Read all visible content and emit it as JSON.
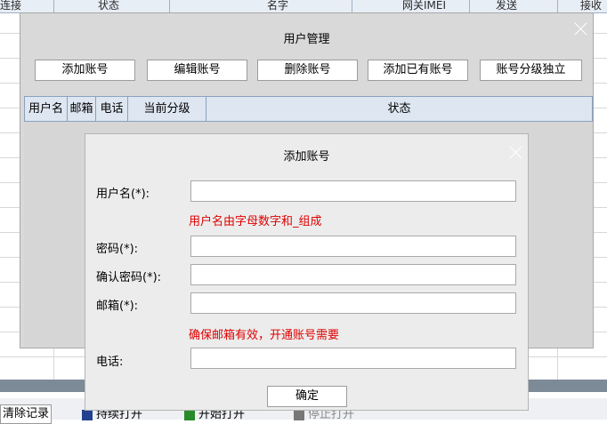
{
  "background": {
    "columns": [
      "连接",
      "状态",
      "名字",
      "网关IMEI",
      "发送",
      "接收"
    ],
    "bottom_buttons": {
      "clear_record": "清除记录",
      "btn2": "持续打开",
      "btn3": "开始打开",
      "btn4": "停止打开"
    }
  },
  "account_manager": {
    "title": "用户管理",
    "toolbar": [
      "添加账号",
      "编辑账号",
      "删除账号",
      "添加已有账号",
      "账号分级独立"
    ],
    "table_headers": [
      "用户名",
      "邮箱",
      "电话",
      "当前分级",
      "状态"
    ]
  },
  "add_account": {
    "title": "添加账号",
    "fields": {
      "username_label": "用户名(*):",
      "username_hint": "用户名由字母数字和_组成",
      "password_label": "密码(*):",
      "confirm_label": "确认密码(*):",
      "email_label": "邮箱(*):",
      "email_hint": "确保邮箱有效，开通账号需要",
      "phone_label": "电话:"
    },
    "ok_label": "确定"
  }
}
